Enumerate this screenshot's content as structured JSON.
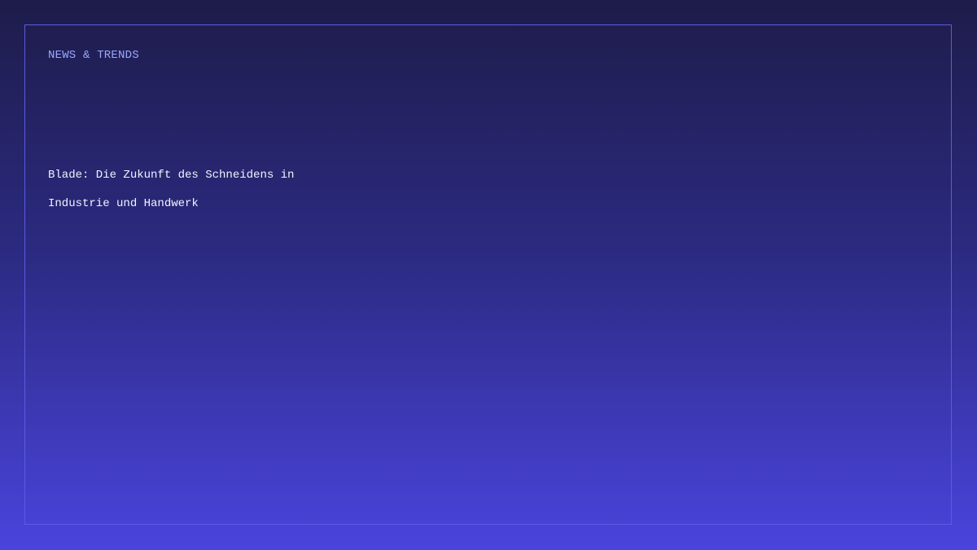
{
  "section_label": "NEWS & TRENDS",
  "headline": {
    "line1": "Blade: Die Zukunft des Schneidens in",
    "line2": "Industrie und Handwerk"
  }
}
